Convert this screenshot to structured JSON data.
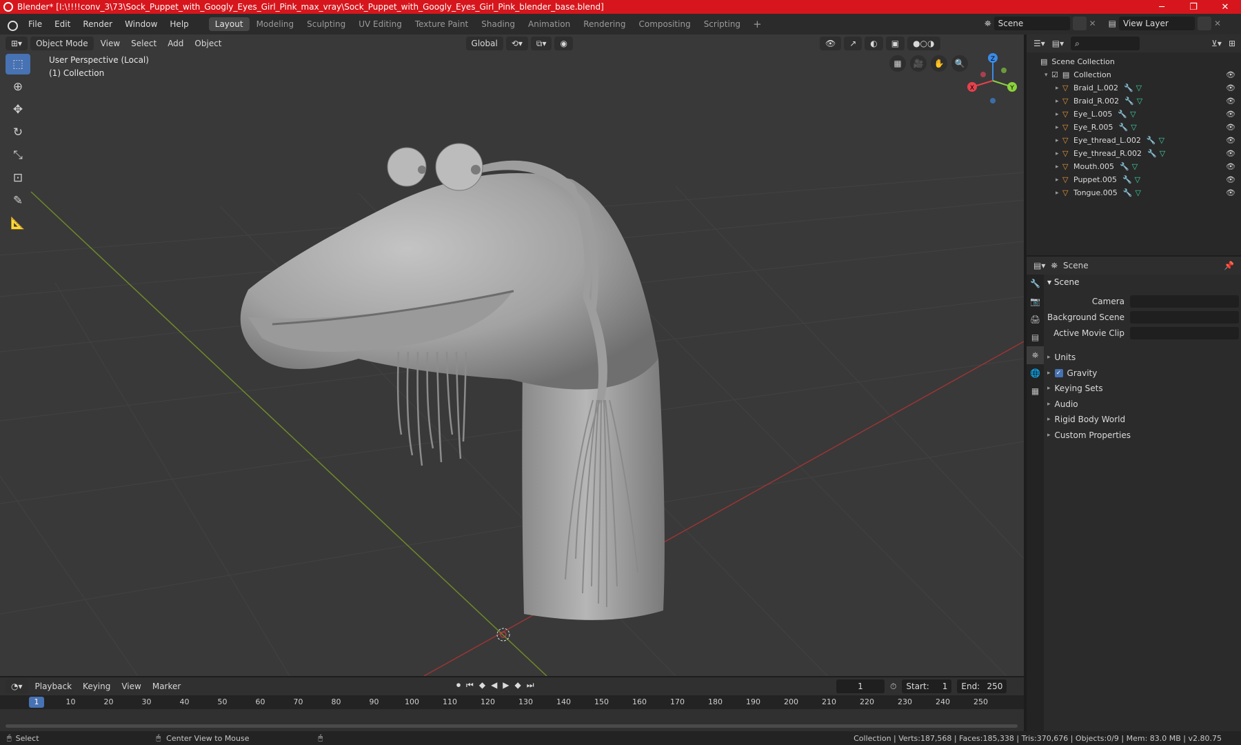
{
  "window": {
    "title": "Blender* [I:\\!!!!conv_3\\73\\Sock_Puppet_with_Googly_Eyes_Girl_Pink_max_vray\\Sock_Puppet_with_Googly_Eyes_Girl_Pink_blender_base.blend]",
    "minimize": "─",
    "maximize": "❐",
    "close": "✕"
  },
  "menu": [
    "File",
    "Edit",
    "Render",
    "Window",
    "Help"
  ],
  "workspaces": [
    "Layout",
    "Modeling",
    "Sculpting",
    "UV Editing",
    "Texture Paint",
    "Shading",
    "Animation",
    "Rendering",
    "Compositing",
    "Scripting"
  ],
  "active_workspace": "Layout",
  "workspace_add": "+",
  "scene_name": "Scene",
  "view_layer": "View Layer",
  "viewport": {
    "mode": "Object Mode",
    "menus": [
      "View",
      "Select",
      "Add",
      "Object"
    ],
    "orientation": "Global",
    "info_line1": "User Perspective (Local)",
    "info_line2": "(1) Collection",
    "gizmo_axes": {
      "x": "X",
      "y": "Y",
      "z": "Z"
    }
  },
  "outliner": {
    "root": "Scene Collection",
    "collection": "Collection",
    "items": [
      "Braid_L.002",
      "Braid_R.002",
      "Eye_L.005",
      "Eye_R.005",
      "Eye_thread_L.002",
      "Eye_thread_R.002",
      "Mouth.005",
      "Puppet.005",
      "Tongue.005"
    ]
  },
  "properties": {
    "header": "Scene",
    "section": "Scene",
    "fields": [
      {
        "label": "Camera"
      },
      {
        "label": "Background Scene"
      },
      {
        "label": "Active Movie Clip"
      }
    ],
    "panels": [
      "Units",
      "Gravity",
      "Keying Sets",
      "Audio",
      "Rigid Body World",
      "Custom Properties"
    ],
    "gravity_checked": true
  },
  "timeline": {
    "menus": [
      "Playback",
      "Keying",
      "View",
      "Marker"
    ],
    "current_frame": "1",
    "start_label": "Start:",
    "start": "1",
    "end_label": "End:",
    "end": "250",
    "ticks": [
      "1",
      "10",
      "20",
      "30",
      "40",
      "50",
      "60",
      "70",
      "80",
      "90",
      "100",
      "110",
      "120",
      "130",
      "140",
      "150",
      "160",
      "170",
      "180",
      "190",
      "200",
      "210",
      "220",
      "230",
      "240",
      "250"
    ]
  },
  "status": {
    "left": "Select",
    "middle": "Center View to Mouse",
    "right": "Collection | Verts:187,568 | Faces:185,338 | Tris:370,676 | Objects:0/9 | Mem: 83.0 MB | v2.80.75"
  },
  "colors": {
    "title_bar": "#d6161c",
    "accent": "#4772b3",
    "object_icon": "#e89a3c",
    "mesh_icon": "#3fd2a5",
    "axis_x": "#e5424d",
    "axis_y": "#8bd13d",
    "axis_z": "#3b8be7"
  }
}
